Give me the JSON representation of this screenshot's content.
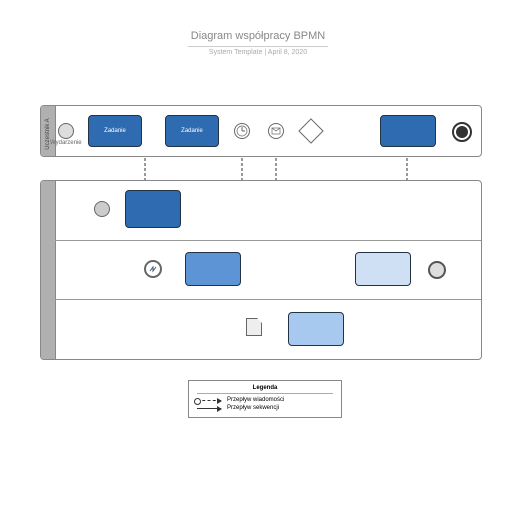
{
  "title": "Diagram współpracy BPMN",
  "subtitle": "System Template  |  April 8, 2020",
  "poolA": {
    "name": "Uczestnik A",
    "startLabel": "Wydarzenie",
    "tasks": [
      "Zadanie",
      "Zadanie"
    ]
  },
  "poolB": {
    "name": " ",
    "lanes": 3
  },
  "legend": {
    "title": "Legenda",
    "msgFlow": "Przepływ wiadomości",
    "seqFlow": "Przepływ sekwencji"
  },
  "colors": {
    "dark": "#2e6bb0",
    "mid": "#5c94d6",
    "light": "#a7c8ef",
    "pale": "#cfe0f4"
  }
}
